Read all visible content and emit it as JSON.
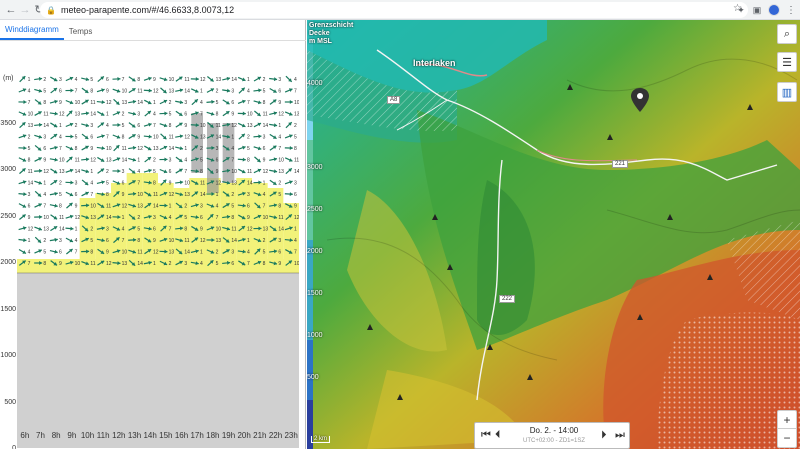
{
  "browser": {
    "url": "meteo-parapente.com/#/46.6633,8.0073,12",
    "back_icon": "arrow-left-icon",
    "forward_icon": "arrow-right-icon",
    "reload_icon": "reload-icon"
  },
  "left": {
    "tabs": [
      {
        "label": "Winddiagramm",
        "active": true
      },
      {
        "label": "Temps",
        "active": false
      }
    ],
    "alt_unit": "(m)",
    "alt_ticks": [
      "3500",
      "3000",
      "2500",
      "2000",
      "1500",
      "1000",
      "500",
      "0"
    ],
    "hours": [
      "6h",
      "7h",
      "8h",
      "9h",
      "10h",
      "11h",
      "12h",
      "13h",
      "14h",
      "15h",
      "16h",
      "17h",
      "18h",
      "19h",
      "20h",
      "21h",
      "22h",
      "23h"
    ],
    "colors": {
      "arrow": "#1a7a5e",
      "thermal": "#f2f27a",
      "ground": "#d0d0d0",
      "cloud": "#999999"
    }
  },
  "map": {
    "legend_title": [
      "Grenzschicht",
      "Decke",
      "m MSL"
    ],
    "scale_ticks": [
      "4000",
      "3000",
      "2500",
      "2000",
      "1500",
      "1000",
      "500"
    ],
    "town_label": "Interlaken",
    "road_labels": [
      "221",
      "222",
      "A8"
    ],
    "scale_bar": "2 km",
    "time_main": "Do. 2. - 14:00",
    "time_sub": "UTC+02:00 - ZD1=1SZ",
    "controls": {
      "first": "⏮",
      "prev": "⏴",
      "next": "⏵",
      "last": "⏭"
    },
    "zoom_in": "+",
    "zoom_out": "−",
    "buttons": [
      {
        "name": "search-icon",
        "glyph": "⌕"
      },
      {
        "name": "settings-sliders-icon",
        "glyph": "☰"
      },
      {
        "name": "chart-icon",
        "glyph": "▥"
      }
    ]
  }
}
